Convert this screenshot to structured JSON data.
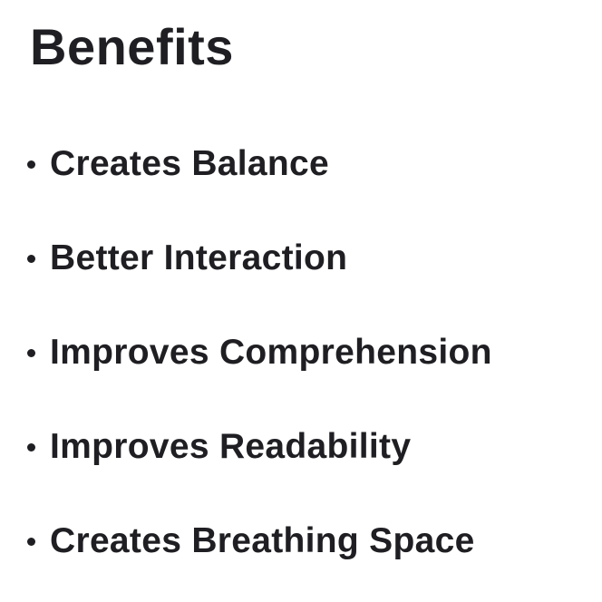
{
  "title": "Benefits",
  "colors": {
    "text": "#1f1f23",
    "background": "#ffffff"
  },
  "benefits": [
    {
      "label": "Creates Balance"
    },
    {
      "label": "Better Interaction"
    },
    {
      "label": "Improves Comprehension"
    },
    {
      "label": "Improves Readability"
    },
    {
      "label": "Creates Breathing Space"
    }
  ]
}
